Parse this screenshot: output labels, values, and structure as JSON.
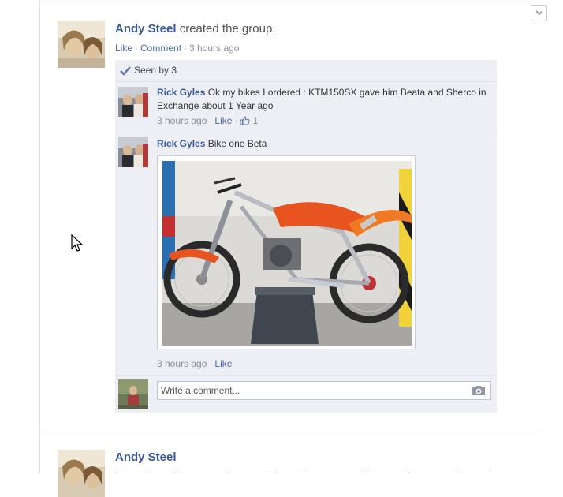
{
  "post": {
    "author": "Andy Steel",
    "action": "created the group.",
    "like_label": "Like",
    "comment_label": "Comment",
    "time": "3 hours ago"
  },
  "seen": {
    "label": "Seen by 3"
  },
  "comments": [
    {
      "author": "Rick Gyles",
      "text": "Ok my bikes I ordered : KTM150SX gave him Beata and Sherco in Exchange about 1 Year ago",
      "time": "3 hours ago",
      "like_label": "Like",
      "like_count": "1"
    },
    {
      "author": "Rick Gyles",
      "text": "Bike one Beta",
      "time": "3 hours ago",
      "like_label": "Like"
    }
  ],
  "composer": {
    "placeholder": "Write a comment..."
  },
  "next_post": {
    "author": "Andy Steel"
  },
  "icons": [
    "chevron-down-icon",
    "checkmark-icon",
    "thumbs-up-icon",
    "camera-icon",
    "mouse-pointer-icon"
  ],
  "colors": {
    "link": "#3b5998",
    "panel": "#edeff4",
    "meta": "#8b8f99"
  }
}
